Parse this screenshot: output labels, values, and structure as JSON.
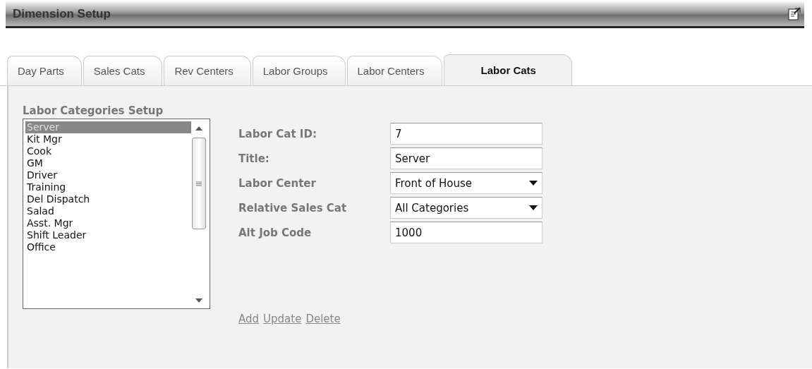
{
  "window": {
    "title": "Dimension Setup"
  },
  "tabs": [
    {
      "label": "Day Parts",
      "selected": false
    },
    {
      "label": "Sales Cats",
      "selected": false
    },
    {
      "label": "Rev Centers",
      "selected": false
    },
    {
      "label": "Labor Groups",
      "selected": false
    },
    {
      "label": "Labor Centers",
      "selected": false
    },
    {
      "label": "Labor Cats",
      "selected": true
    }
  ],
  "list_section": {
    "heading": "Labor Categories Setup",
    "items": [
      {
        "label": "Server",
        "selected": true
      },
      {
        "label": "Kit Mgr",
        "selected": false
      },
      {
        "label": "Cook",
        "selected": false
      },
      {
        "label": "GM",
        "selected": false
      },
      {
        "label": "Driver",
        "selected": false
      },
      {
        "label": "Training",
        "selected": false
      },
      {
        "label": "Del Dispatch",
        "selected": false
      },
      {
        "label": "Salad",
        "selected": false
      },
      {
        "label": "Asst. Mgr",
        "selected": false
      },
      {
        "label": "Shift Leader",
        "selected": false
      },
      {
        "label": "Office",
        "selected": false
      }
    ]
  },
  "form": {
    "fields": [
      {
        "label": "Labor Cat ID:",
        "kind": "text",
        "value": "7"
      },
      {
        "label": "Title:",
        "kind": "text",
        "value": "Server"
      },
      {
        "label": "Labor Center",
        "kind": "select",
        "value": "Front of House"
      },
      {
        "label": "Relative Sales Cat",
        "kind": "select",
        "value": "All Categories"
      },
      {
        "label": "Alt Job Code",
        "kind": "text",
        "value": "1000"
      }
    ],
    "links": [
      "Add",
      "Update",
      "Delete"
    ]
  }
}
